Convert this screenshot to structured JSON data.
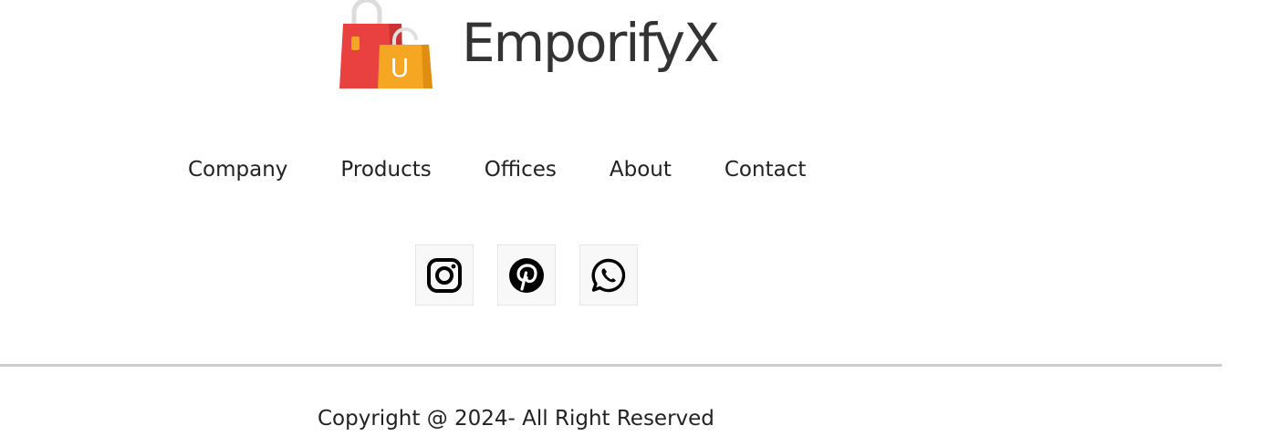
{
  "brand": {
    "name": "EmporifyX",
    "logo_icon": "shopping-bags-logo",
    "logo_letter": "U"
  },
  "nav": {
    "items": [
      {
        "label": "Company"
      },
      {
        "label": "Products"
      },
      {
        "label": "Offices"
      },
      {
        "label": "About"
      },
      {
        "label": "Contact"
      }
    ]
  },
  "social": {
    "items": [
      {
        "icon": "instagram-icon"
      },
      {
        "icon": "pinterest-icon"
      },
      {
        "icon": "whatsapp-icon"
      }
    ]
  },
  "footer": {
    "copyright": "Copyright @ 2024- All Right Reserved"
  },
  "colors": {
    "bag_red": "#e94040",
    "bag_orange": "#f5a623",
    "text": "#222222",
    "divider": "#cccccc"
  }
}
